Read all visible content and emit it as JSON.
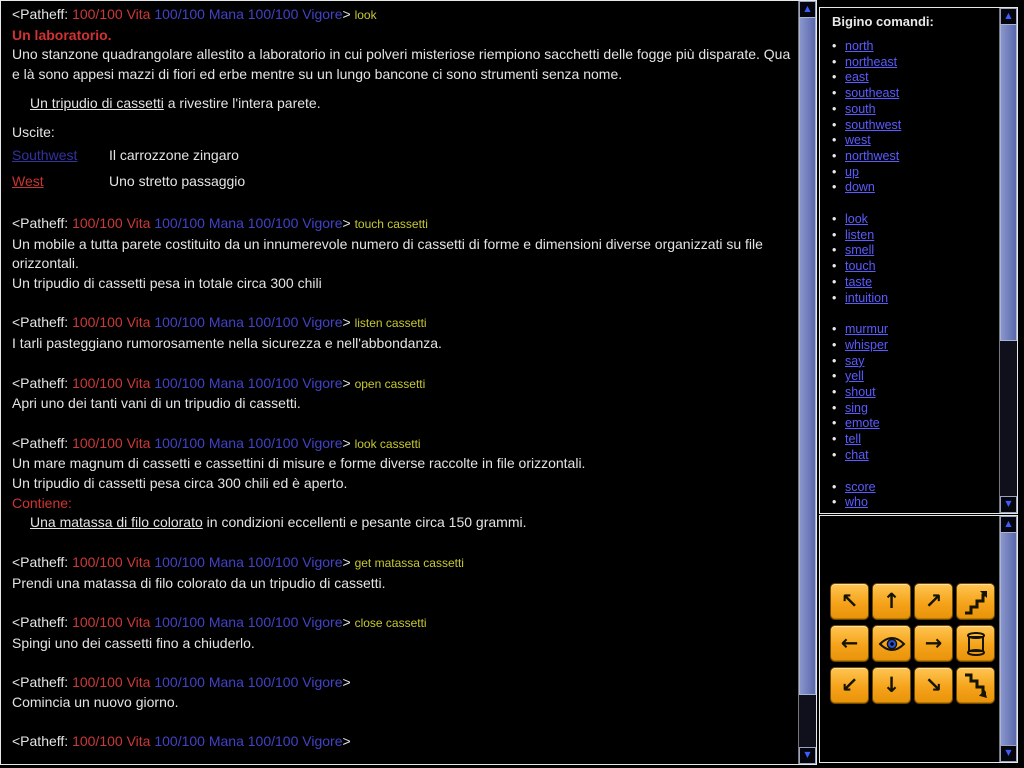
{
  "colors": {
    "background": "#000000",
    "body_text": "#e4e4e4",
    "room_title": "#d23232",
    "vita": "#cc3838",
    "mana": "#4242c6",
    "vigore": "#4242c6",
    "command_echo": "#c8c832",
    "panel_link": "#5b5bff",
    "exit_link_blue": "#3232a0",
    "exit_link_red": "#c83434",
    "button_orange": "#f5a31a"
  },
  "icons": {
    "scroll_up": "▲",
    "scroll_down": "▼"
  },
  "prompt": {
    "open": "<Patheff: ",
    "vita": "100/100 Vita",
    "mana": "100/100 Mana",
    "vigore": "100/100 Vigore",
    "close": "> "
  },
  "terminal": {
    "lines": [
      {
        "kind": "prompt",
        "command": "look"
      },
      {
        "kind": "para",
        "segs": [
          {
            "t": "Un laboratorio.",
            "s": "title"
          }
        ]
      },
      {
        "kind": "para",
        "segs": [
          {
            "t": "Uno stanzone quadrangolare allestito a laboratorio in cui polveri misteriose riempiono sacchetti delle fogge più disparate. Qua e là sono appesi mazzi di fiori ed erbe mentre su un lungo bancone ci sono strumenti senza nome.",
            "s": "w"
          }
        ]
      },
      {
        "kind": "item",
        "segs": [
          {
            "t": "Un tripudio di cassetti",
            "s": "linkw",
            "name": "room-item-link-cassetti"
          },
          {
            "t": " a rivestire l'intera parete.",
            "s": "w"
          }
        ]
      },
      {
        "kind": "exits-header",
        "segs": [
          {
            "t": "Uscite:",
            "s": "w"
          }
        ]
      },
      {
        "kind": "exit",
        "name": "Southwest",
        "style": "linkb",
        "desc": "Il carrozzone zingaro"
      },
      {
        "kind": "exit",
        "name": "West",
        "style": "linkr",
        "desc": "Uno stretto passaggio"
      },
      {
        "kind": "gap"
      },
      {
        "kind": "prompt",
        "command": "touch cassetti"
      },
      {
        "kind": "para",
        "segs": [
          {
            "t": "Un mobile a tutta parete costituito da un innumerevole numero di cassetti di forme e dimensioni diverse organizzati su file orizzontali.",
            "s": "w"
          }
        ]
      },
      {
        "kind": "para",
        "segs": [
          {
            "t": "Un tripudio di cassetti pesa in totale circa 300 chili",
            "s": "w"
          }
        ]
      },
      {
        "kind": "gap"
      },
      {
        "kind": "prompt",
        "command": "listen cassetti"
      },
      {
        "kind": "para",
        "segs": [
          {
            "t": "I tarli pasteggiano rumorosamente nella sicurezza e nell'abbondanza.",
            "s": "w"
          }
        ]
      },
      {
        "kind": "gap"
      },
      {
        "kind": "prompt",
        "command": "open cassetti"
      },
      {
        "kind": "para",
        "segs": [
          {
            "t": "Apri uno dei tanti vani di un tripudio di cassetti.",
            "s": "w"
          }
        ]
      },
      {
        "kind": "gap"
      },
      {
        "kind": "prompt",
        "command": "look cassetti"
      },
      {
        "kind": "para",
        "segs": [
          {
            "t": "Un mare magnum di cassetti e cassettini di misure e forme diverse raccolte in file orizzontali.",
            "s": "w"
          }
        ]
      },
      {
        "kind": "para",
        "segs": [
          {
            "t": "Un tripudio di cassetti pesa circa 300 chili ed è aperto.",
            "s": "w"
          }
        ]
      },
      {
        "kind": "para",
        "segs": [
          {
            "t": "Contiene:",
            "s": "red"
          }
        ]
      },
      {
        "kind": "indent",
        "segs": [
          {
            "t": "Una matassa di filo colorato",
            "s": "linkw",
            "name": "item-link-matassa"
          },
          {
            "t": " in condizioni eccellenti e pesante circa 150 grammi.",
            "s": "w"
          }
        ]
      },
      {
        "kind": "gap"
      },
      {
        "kind": "prompt",
        "command": "get matassa cassetti"
      },
      {
        "kind": "para",
        "segs": [
          {
            "t": "Prendi una matassa di filo colorato da un tripudio di cassetti.",
            "s": "w"
          }
        ]
      },
      {
        "kind": "gap"
      },
      {
        "kind": "prompt",
        "command": "close cassetti"
      },
      {
        "kind": "para",
        "segs": [
          {
            "t": "Spingi uno dei cassetti fino a chiuderlo.",
            "s": "w"
          }
        ]
      },
      {
        "kind": "gap"
      },
      {
        "kind": "prompt",
        "command": ""
      },
      {
        "kind": "para",
        "segs": [
          {
            "t": "Comincia un nuovo giorno.",
            "s": "w"
          }
        ]
      },
      {
        "kind": "gap"
      },
      {
        "kind": "prompt",
        "command": ""
      }
    ]
  },
  "commands_panel": {
    "title": "Bigino comandi:",
    "groups": [
      {
        "items": [
          "north",
          "northeast",
          "east",
          "southeast",
          "south",
          "southwest",
          "west",
          "northwest",
          "up",
          "down"
        ]
      },
      {
        "items": [
          "look",
          "listen",
          "smell",
          "touch",
          "taste",
          "intuition"
        ]
      },
      {
        "items": [
          "murmur",
          "whisper",
          "say",
          "yell",
          "shout",
          "sing",
          "emote",
          "tell",
          "chat"
        ]
      },
      {
        "items": [
          "score",
          "who"
        ]
      }
    ]
  },
  "nav_panel": {
    "buttons": [
      {
        "id": "move-northwest",
        "icon": "arrow",
        "icon_name": "arrow-northwest-icon",
        "glyph": "↖"
      },
      {
        "id": "move-north",
        "icon": "arrow",
        "icon_name": "arrow-north-icon",
        "glyph": "↑"
      },
      {
        "id": "move-northeast",
        "icon": "arrow",
        "icon_name": "arrow-northeast-icon",
        "glyph": "↗"
      },
      {
        "id": "move-up",
        "icon": "stairs-up",
        "icon_name": "stairs-up-icon"
      },
      {
        "id": "move-west",
        "icon": "arrow",
        "icon_name": "arrow-west-icon",
        "glyph": "←"
      },
      {
        "id": "look",
        "icon": "eye",
        "icon_name": "eye-icon"
      },
      {
        "id": "move-east",
        "icon": "arrow",
        "icon_name": "arrow-east-icon",
        "glyph": "→"
      },
      {
        "id": "scroll",
        "icon": "scroll",
        "icon_name": "scroll-icon"
      },
      {
        "id": "move-southwest",
        "icon": "arrow",
        "icon_name": "arrow-southwest-icon",
        "glyph": "↙"
      },
      {
        "id": "move-south",
        "icon": "arrow",
        "icon_name": "arrow-south-icon",
        "glyph": "↓"
      },
      {
        "id": "move-southeast",
        "icon": "arrow",
        "icon_name": "arrow-southeast-icon",
        "glyph": "↘"
      },
      {
        "id": "move-down",
        "icon": "stairs-down",
        "icon_name": "stairs-down-icon"
      }
    ]
  }
}
